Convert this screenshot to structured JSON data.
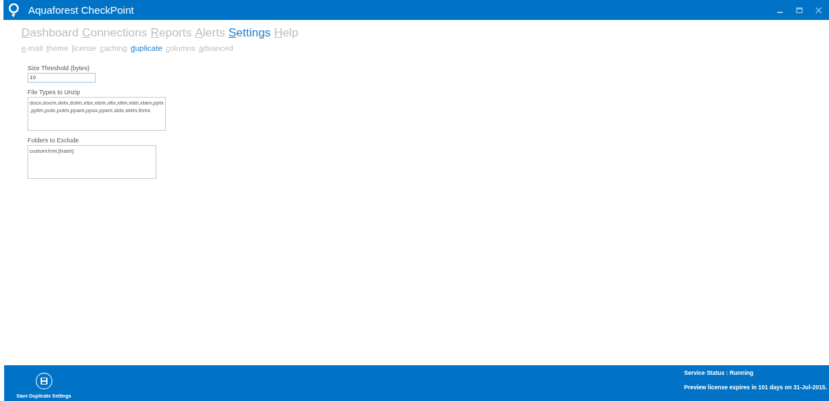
{
  "window": {
    "title": "Aquaforest CheckPoint"
  },
  "main_menu": [
    {
      "label": "Dashboard",
      "selected": false
    },
    {
      "label": "Connections",
      "selected": false
    },
    {
      "label": "Reports",
      "selected": false
    },
    {
      "label": "Alerts",
      "selected": false
    },
    {
      "label": "Settings",
      "selected": true
    },
    {
      "label": "Help",
      "selected": false
    }
  ],
  "sub_menu": [
    {
      "label": "e-mail",
      "selected": false
    },
    {
      "label": "theme",
      "selected": false
    },
    {
      "label": "license",
      "selected": false
    },
    {
      "label": "caching",
      "selected": false
    },
    {
      "label": "duplicate",
      "selected": true
    },
    {
      "label": "columns",
      "selected": false
    },
    {
      "label": "advanced",
      "selected": false
    }
  ],
  "fields": [
    {
      "kind": "input",
      "label": "Size Threshold (bytes)",
      "value": "10"
    },
    {
      "kind": "textarea",
      "label": "File Types to Unzip",
      "value": "docx,docm,dotx,dotm,xlsx,xlsm,xltx,xltm,xlsb,xlam,pptx\n,pptm,potx,potm,ppam,ppsx,ppsm,sldx,sldm,thmx"
    },
    {
      "kind": "textarea",
      "label": "Folders to Exclude",
      "value": "customXml,[trash]"
    }
  ],
  "footer": {
    "button": "Save Duplicate Settings",
    "service_status": "Service Status :  Running",
    "license_notice": "Preview license expires in 101 days on 31-Jul-2015."
  }
}
